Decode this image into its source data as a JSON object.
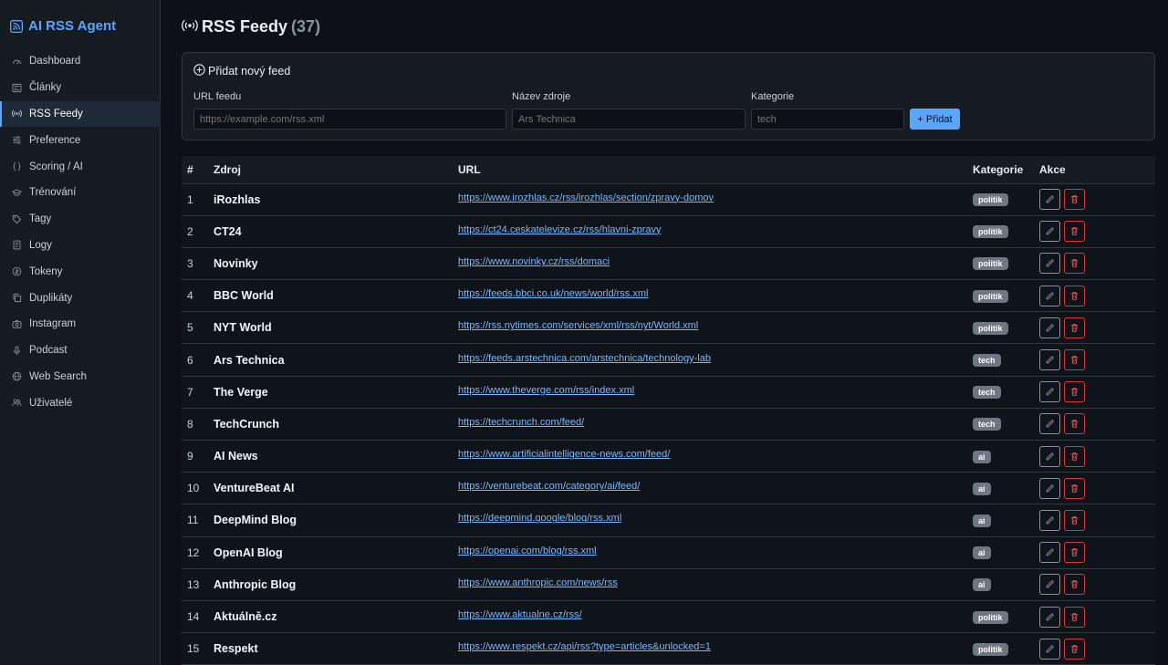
{
  "app": {
    "title": "AI RSS Agent"
  },
  "sidebar": {
    "items": [
      {
        "label": "Dashboard",
        "icon": "gauge-icon",
        "active": false
      },
      {
        "label": "Články",
        "icon": "newspaper-icon",
        "active": false
      },
      {
        "label": "RSS Feedy",
        "icon": "broadcast-icon",
        "active": true
      },
      {
        "label": "Preference",
        "icon": "sliders-icon",
        "active": false
      },
      {
        "label": "Scoring / AI",
        "icon": "braces-icon",
        "active": false
      },
      {
        "label": "Trénování",
        "icon": "mortarboard-icon",
        "active": false
      },
      {
        "label": "Tagy",
        "icon": "tag-icon",
        "active": false
      },
      {
        "label": "Logy",
        "icon": "journal-icon",
        "active": false
      },
      {
        "label": "Tokeny",
        "icon": "coin-icon",
        "active": false
      },
      {
        "label": "Duplikáty",
        "icon": "copy-icon",
        "active": false
      },
      {
        "label": "Instagram",
        "icon": "camera-icon",
        "active": false
      },
      {
        "label": "Podcast",
        "icon": "mic-icon",
        "active": false
      },
      {
        "label": "Web Search",
        "icon": "globe-icon",
        "active": false
      },
      {
        "label": "Uživatelé",
        "icon": "people-icon",
        "active": false
      }
    ]
  },
  "page": {
    "title": "RSS Feedy",
    "count": "(37)"
  },
  "add_form": {
    "title": "Přidat nový feed",
    "url_label": "URL feedu",
    "url_placeholder": "https://example.com/rss.xml",
    "name_label": "Název zdroje",
    "name_placeholder": "Ars Technica",
    "category_label": "Kategorie",
    "category_placeholder": "tech",
    "submit_label": "Přidat"
  },
  "table": {
    "headers": {
      "num": "#",
      "source": "Zdroj",
      "url": "URL",
      "category": "Kategorie",
      "actions": "Akce"
    },
    "rows": [
      {
        "num": "1",
        "name": "iRozhlas",
        "url": "https://www.irozhlas.cz/rss/irozhlas/section/zpravy-domov",
        "category": "politik"
      },
      {
        "num": "2",
        "name": "CT24",
        "url": "https://ct24.ceskatelevize.cz/rss/hlavni-zpravy",
        "category": "politik"
      },
      {
        "num": "3",
        "name": "Novinky",
        "url": "https://www.novinky.cz/rss/domaci",
        "category": "politik"
      },
      {
        "num": "4",
        "name": "BBC World",
        "url": "https://feeds.bbci.co.uk/news/world/rss.xml",
        "category": "politik"
      },
      {
        "num": "5",
        "name": "NYT World",
        "url": "https://rss.nytimes.com/services/xml/rss/nyt/World.xml",
        "category": "politik"
      },
      {
        "num": "6",
        "name": "Ars Technica",
        "url": "https://feeds.arstechnica.com/arstechnica/technology-lab",
        "category": "tech"
      },
      {
        "num": "7",
        "name": "The Verge",
        "url": "https://www.theverge.com/rss/index.xml",
        "category": "tech"
      },
      {
        "num": "8",
        "name": "TechCrunch",
        "url": "https://techcrunch.com/feed/",
        "category": "tech"
      },
      {
        "num": "9",
        "name": "AI News",
        "url": "https://www.artificialintelligence-news.com/feed/",
        "category": "ai"
      },
      {
        "num": "10",
        "name": "VentureBeat AI",
        "url": "https://venturebeat.com/category/ai/feed/",
        "category": "ai"
      },
      {
        "num": "11",
        "name": "DeepMind Blog",
        "url": "https://deepmind.google/blog/rss.xml",
        "category": "ai"
      },
      {
        "num": "12",
        "name": "OpenAI Blog",
        "url": "https://openai.com/blog/rss.xml",
        "category": "ai"
      },
      {
        "num": "13",
        "name": "Anthropic Blog",
        "url": "https://www.anthropic.com/news/rss",
        "category": "ai"
      },
      {
        "num": "14",
        "name": "Aktuálně.cz",
        "url": "https://www.aktualne.cz/rss/",
        "category": "politik"
      },
      {
        "num": "15",
        "name": "Respekt",
        "url": "https://www.respekt.cz/api/rss?type=articles&unlocked=1",
        "category": "politik"
      }
    ]
  },
  "colors": {
    "accent": "#58a6ff",
    "danger": "#da3633",
    "badge": "#6e7681",
    "background": "#0d1117"
  }
}
